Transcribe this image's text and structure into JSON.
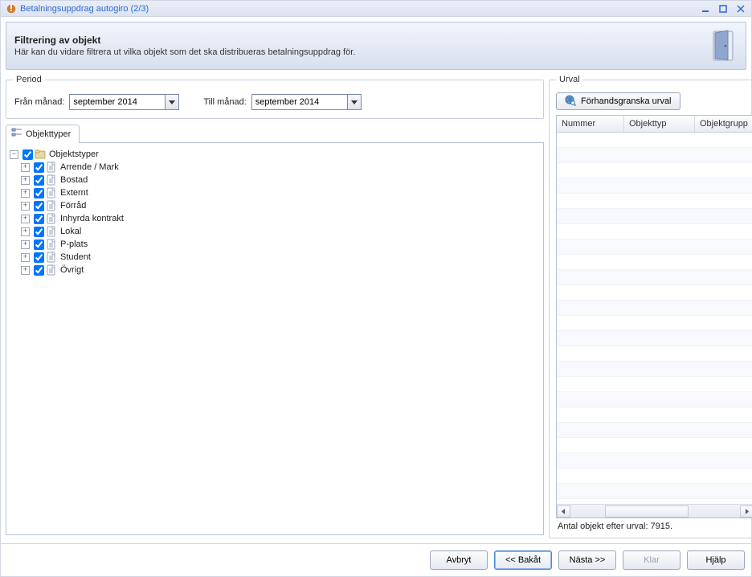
{
  "titlebar": {
    "title": "Betalningsuppdrag autogiro (2/3)"
  },
  "header": {
    "title": "Filtrering av objekt",
    "subtitle": "Här kan du vidare filtrera ut vilka objekt som det ska distribueras betalningsuppdrag för."
  },
  "period": {
    "legend": "Period",
    "from_label": "Från månad:",
    "to_label": "Till månad:",
    "from_value": "september 2014",
    "to_value": "september 2014"
  },
  "tabs": {
    "objekttyper": "Objekttyper"
  },
  "tree": {
    "root": "Objektstyper",
    "items": [
      "Arrende / Mark",
      "Bostad",
      "Externt",
      "Förråd",
      "Inhyrda kontrakt",
      "Lokal",
      "P-plats",
      "Student",
      "Övrigt"
    ]
  },
  "urval": {
    "legend": "Urval",
    "preview_button": "Förhandsgranska urval",
    "columns": {
      "nummer": "Nummer",
      "objekttyp": "Objekttyp",
      "objektgrupp": "Objektgrupp"
    },
    "count_label": "Antal objekt efter urval: 7915."
  },
  "footer": {
    "avbryt": "Avbryt",
    "bakat": "<< Bakåt",
    "nasta": "Nästa >>",
    "klar": "Klar",
    "hjalp": "Hjälp"
  }
}
